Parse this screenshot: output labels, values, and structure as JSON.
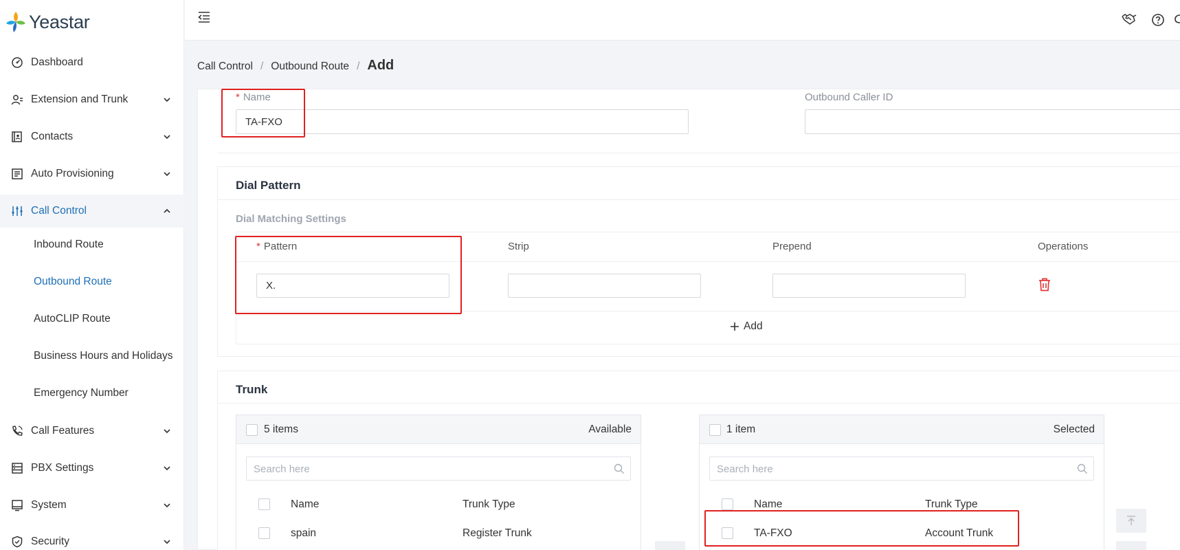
{
  "brand": {
    "name": "Yeastar"
  },
  "sidebar": {
    "items": [
      {
        "label": "Dashboard"
      },
      {
        "label": "Extension and Trunk"
      },
      {
        "label": "Contacts"
      },
      {
        "label": "Auto Provisioning"
      },
      {
        "label": "Call Control"
      },
      {
        "label": "Call Features"
      },
      {
        "label": "PBX Settings"
      },
      {
        "label": "System"
      },
      {
        "label": "Security"
      }
    ],
    "sub_items": [
      {
        "label": "Inbound Route"
      },
      {
        "label": "Outbound Route"
      },
      {
        "label": "AutoCLIP Route"
      },
      {
        "label": "Business Hours and Holidays"
      },
      {
        "label": "Emergency Number"
      }
    ],
    "active_item": "Call Control",
    "active_sub_item": "Outbound Route",
    "accent_color": "#1f6fb5"
  },
  "breadcrumb": {
    "items": [
      "Call Control",
      "Outbound Route"
    ],
    "current": "Add",
    "separator": "/"
  },
  "form": {
    "name_label": "Name",
    "name_value": "TA-FXO",
    "caller_id_label": "Outbound Caller ID",
    "caller_id_value": "",
    "required_mark": "*"
  },
  "dial_pattern": {
    "title": "Dial Pattern",
    "subtitle": "Dial Matching Settings",
    "columns": {
      "pattern": "Pattern",
      "strip": "Strip",
      "prepend": "Prepend",
      "operations": "Operations"
    },
    "row": {
      "pattern": "X.",
      "strip": "",
      "prepend": ""
    },
    "add_label": "Add"
  },
  "trunk": {
    "title": "Trunk",
    "available": {
      "count_label": "5 items",
      "panel_label": "Available",
      "search_placeholder": "Search here",
      "columns": {
        "name": "Name",
        "type": "Trunk Type"
      },
      "rows": [
        {
          "name": "spain",
          "type": "Register Trunk"
        }
      ]
    },
    "selected": {
      "count_label": "1 item",
      "panel_label": "Selected",
      "search_placeholder": "Search here",
      "columns": {
        "name": "Name",
        "type": "Trunk Type"
      },
      "rows": [
        {
          "name": "TA-FXO",
          "type": "Account Trunk"
        }
      ]
    }
  },
  "colors": {
    "highlight_box": "#e02020",
    "required": "#e03a3a",
    "delete_icon": "#e03a3a"
  }
}
